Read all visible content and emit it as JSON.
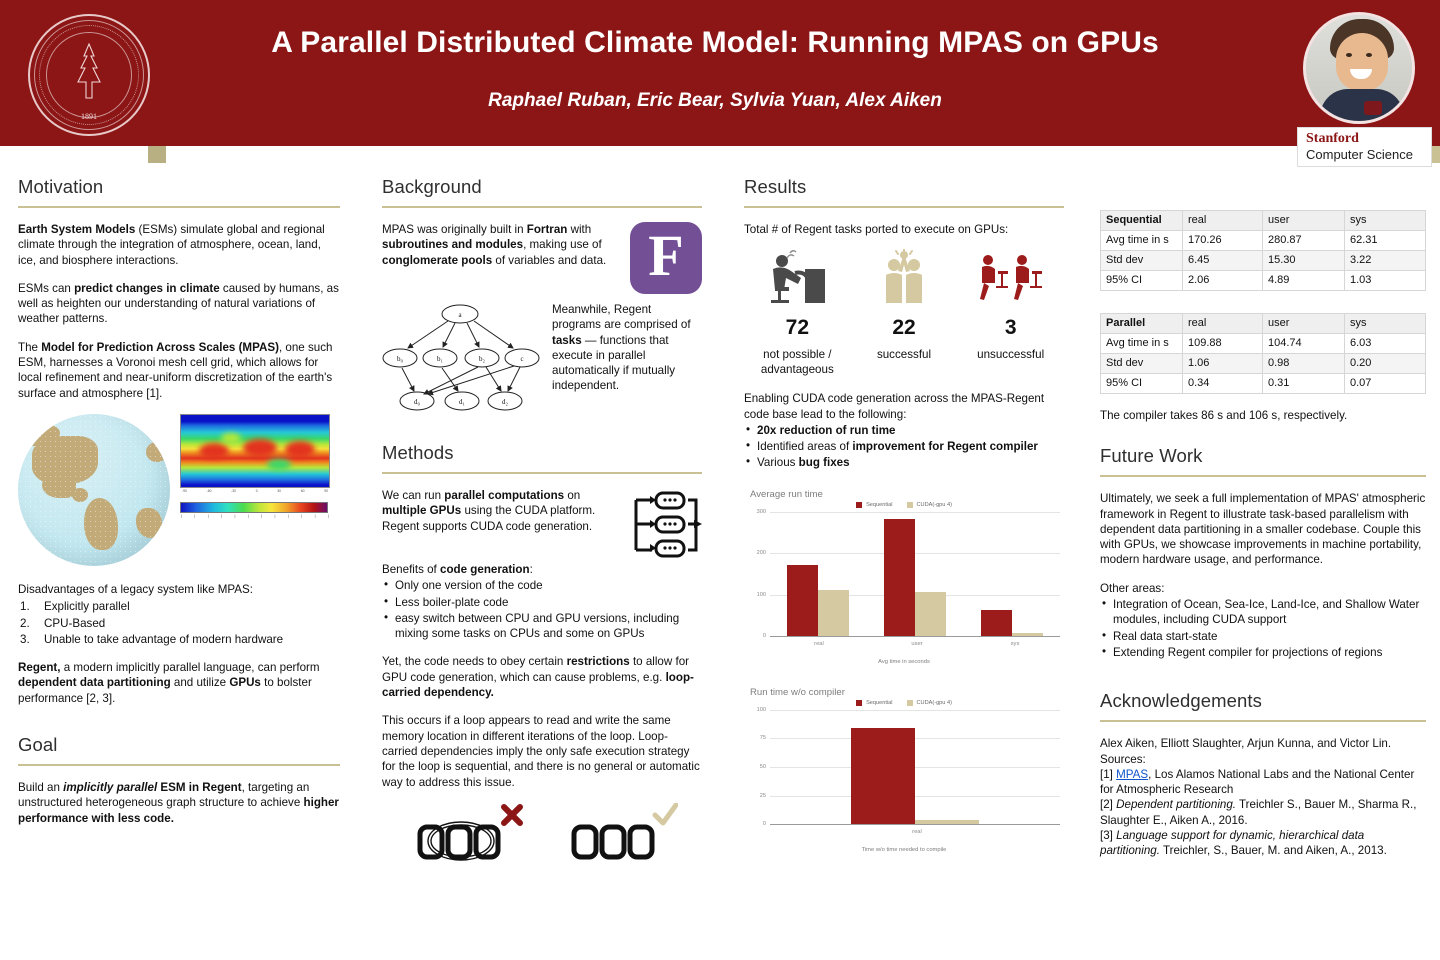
{
  "header": {
    "title": "A Parallel Distributed Climate Model: Running MPAS on GPUs",
    "authors": "Raphael Ruban, Eric Bear, Sylvia Yuan, Alex Aiken",
    "seal_year": "1891",
    "seal_text": "THE LELAND STANFORD JUNIOR UNIVERSITY · DIE LUFT DER FREIHEIT WEHT ·",
    "logo_line1": "Stanford",
    "logo_line2": "Computer Science"
  },
  "colors": {
    "cardinal": "#8c1515",
    "gold": "#c9c093",
    "bar_sequential": "#9c1b1b",
    "bar_cuda": "#d4c9a0",
    "fortran_purple": "#734f96"
  },
  "motivation": {
    "heading": "Motivation",
    "p1_bold": "Earth System Models",
    "p1_rest": " (ESMs) simulate global and regional climate through the integration of atmosphere, ocean, land, ice, and biosphere interactions.",
    "p2_pre": "ESMs can ",
    "p2_bold": "predict changes in climate",
    "p2_rest": " caused by humans, as well as heighten our understanding of natural variations of weather patterns.",
    "p3_pre": "The ",
    "p3_bold": "Model for Prediction Across Scales (MPAS)",
    "p3_rest": ", one such ESM, harnesses a Voronoi mesh cell grid, which allows for local refinement and near-uniform discretization of the earth's surface and atmosphere [1].",
    "disadvantages_intro": "Disadvantages  of a legacy system like MPAS:",
    "disadvantages": [
      {
        "num": "1.",
        "text": "Explicitly parallel"
      },
      {
        "num": "2.",
        "text": "CPU-Based"
      },
      {
        "num": "3.",
        "text": "Unable to take advantage of modern hardware"
      }
    ],
    "p4_bold": "Regent,",
    "p4_mid": " a modern implicitly parallel language, can perform ",
    "p4_bold2": "dependent data partitioning",
    "p4_mid2": " and utilize ",
    "p4_bold3": "GPUs",
    "p4_end": " to bolster performance [2, 3]."
  },
  "goal": {
    "heading": "Goal",
    "pre": "Build an ",
    "bolditalic": "implicitly parallel",
    "bold1": " ESM in Regent",
    "mid": ", targeting an unstructured heterogeneous graph structure to achieve ",
    "bold2": "higher performance with less code."
  },
  "background": {
    "heading": "Background",
    "p1_pre": "MPAS was originally built in ",
    "p1_b1": "Fortran",
    "p1_m1": " with ",
    "p1_b2": "subroutines and modules",
    "p1_m2": ", making use of ",
    "p1_b3": "conglomerate pools",
    "p1_end": " of variables and data.",
    "fortran_letter": "F",
    "dag_nodes": [
      "a",
      "b",
      "b",
      "b",
      "c",
      "d",
      "d",
      "d"
    ],
    "p2_pre": "Meanwhile, Regent programs are comprised of ",
    "p2_bold": "tasks",
    "p2_end": " — functions that execute in parallel automatically if mutually independent."
  },
  "methods": {
    "heading": "Methods",
    "p1_pre": "We can run ",
    "p1_b1": "parallel computations",
    "p1_m1": " on ",
    "p1_b2": "multiple GPUs",
    "p1_end": " using the CUDA platform. Regent supports CUDA code generation.",
    "benefits_pre": "Benefits of ",
    "benefits_bold": "code generation",
    "benefits_colon": ":",
    "benefits": [
      "Only one version of the code",
      "Less boiler-plate code",
      "easy switch between CPU and GPU versions, including mixing some tasks on CPUs and some on GPUs"
    ],
    "p2_pre": "Yet, the code needs to obey certain ",
    "p2_b1": "restrictions",
    "p2_m1": " to allow for GPU code generation, which can cause problems, e.g. ",
    "p2_b2": "loop-carried dependency.",
    "p3": "This occurs if a loop appears to read and write the same memory location in different iterations of the loop. Loop-carried dependencies imply the only safe execution strategy for the loop is sequential, and there is no general or automatic way to address this issue.",
    "bad_mark": "✕",
    "good_mark": "✓"
  },
  "results": {
    "heading": "Results",
    "intro": "Total # of Regent tasks ported to execute on GPUs:",
    "stats": [
      {
        "icon": "person-at-desk-icon",
        "value": "72",
        "label": "not possible / advantageous"
      },
      {
        "icon": "high-five-icon",
        "value": "22",
        "label": "successful"
      },
      {
        "icon": "frustrated-person-icon",
        "value": "3",
        "label": "unsuccessful"
      }
    ],
    "enabling_intro": "Enabling CUDA code generation across the MPAS-Regent code base lead to the following:",
    "bullets": [
      {
        "bold": "20x reduction of run time",
        "plain": ""
      },
      {
        "plain": "Identified areas of ",
        "bold": "improvement for Regent compiler"
      },
      {
        "plain": "Various ",
        "bold": "bug fixes"
      }
    ]
  },
  "chart_data": [
    {
      "type": "bar",
      "title": "Average run time",
      "categories": [
        "real",
        "user",
        "sys"
      ],
      "series": [
        {
          "name": "Sequential",
          "values": [
            170.26,
            280.87,
            62.31
          ],
          "color": "#9c1b1b"
        },
        {
          "name": "CUDA(-gpu 4)",
          "values": [
            109.88,
            104.74,
            6.03
          ],
          "color": "#d4c9a0"
        }
      ],
      "xlabel": "Avg time in seconds",
      "ylabel": "",
      "ylim": [
        0,
        300
      ],
      "yticks": [
        0,
        100,
        200,
        300
      ],
      "grid": true,
      "legend_position": "top"
    },
    {
      "type": "bar",
      "title": "Run time w/o compiler",
      "categories": [
        "real"
      ],
      "series": [
        {
          "name": "Sequential",
          "values": [
            83.5
          ],
          "color": "#9c1b1b"
        },
        {
          "name": "CUDA(-gpu 4)",
          "values": [
            3.5
          ],
          "color": "#d4c9a0"
        }
      ],
      "xlabel": "Time w/o time needed to compile",
      "ylabel": "",
      "ylim": [
        0,
        100
      ],
      "yticks": [
        0,
        25,
        50,
        75,
        100
      ],
      "grid": true,
      "legend_position": "top"
    }
  ],
  "tables": [
    {
      "name": "sequential-table",
      "header": [
        "Sequential",
        "real",
        "user",
        "sys"
      ],
      "rows": [
        [
          "Avg time in s",
          "170.26",
          "280.87",
          "62.31"
        ],
        [
          "Std dev",
          "6.45",
          "15.30",
          "3.22"
        ],
        [
          "95% CI",
          "2.06",
          "4.89",
          "1.03"
        ]
      ]
    },
    {
      "name": "parallel-table",
      "header": [
        "Parallel",
        "real",
        "user",
        "sys"
      ],
      "rows": [
        [
          "Avg time in s",
          "109.88",
          "104.74",
          "6.03"
        ],
        [
          "Std dev",
          "1.06",
          "0.98",
          "0.20"
        ],
        [
          "95% CI",
          "0.34",
          "0.31",
          "0.07"
        ]
      ]
    }
  ],
  "compiler_note": "The compiler takes 86 s and 106 s, respectively.",
  "future_work": {
    "heading": "Future Work",
    "p1": "Ultimately, we seek a full implementation of MPAS' atmospheric framework in Regent to illustrate task-based parallelism with dependent data partitioning in a smaller codebase. Couple this with GPUs, we showcase improvements in machine portability, modern hardware usage, and performance.",
    "other_intro": "Other areas:",
    "bullets": [
      "Integration of Ocean, Sea-Ice, Land-Ice, and Shallow Water modules, including CUDA support",
      "Real data start-state",
      "Extending Regent compiler for projections of regions"
    ]
  },
  "acknowledgements": {
    "heading": "Acknowledgements",
    "people": "Alex Aiken, Elliott Slaughter, Arjun Kunna, and Victor Lin.",
    "sources_label": "Sources:",
    "ref1_num": "[1] ",
    "ref1_link": "MPAS",
    "ref1_rest": ", Los Alamos National Labs and the National Center for Atmospheric Research",
    "ref2_num": "[2] ",
    "ref2_italic": "Dependent partitioning.",
    "ref2_rest": " Treichler S., Bauer M., Sharma R., Slaughter E., Aiken A., 2016.",
    "ref3_num": "[3] ",
    "ref3_italic": "Language support for dynamic, hierarchical data partitioning.",
    "ref3_rest": " Treichler, S., Bauer, M. and Aiken, A., 2013."
  }
}
